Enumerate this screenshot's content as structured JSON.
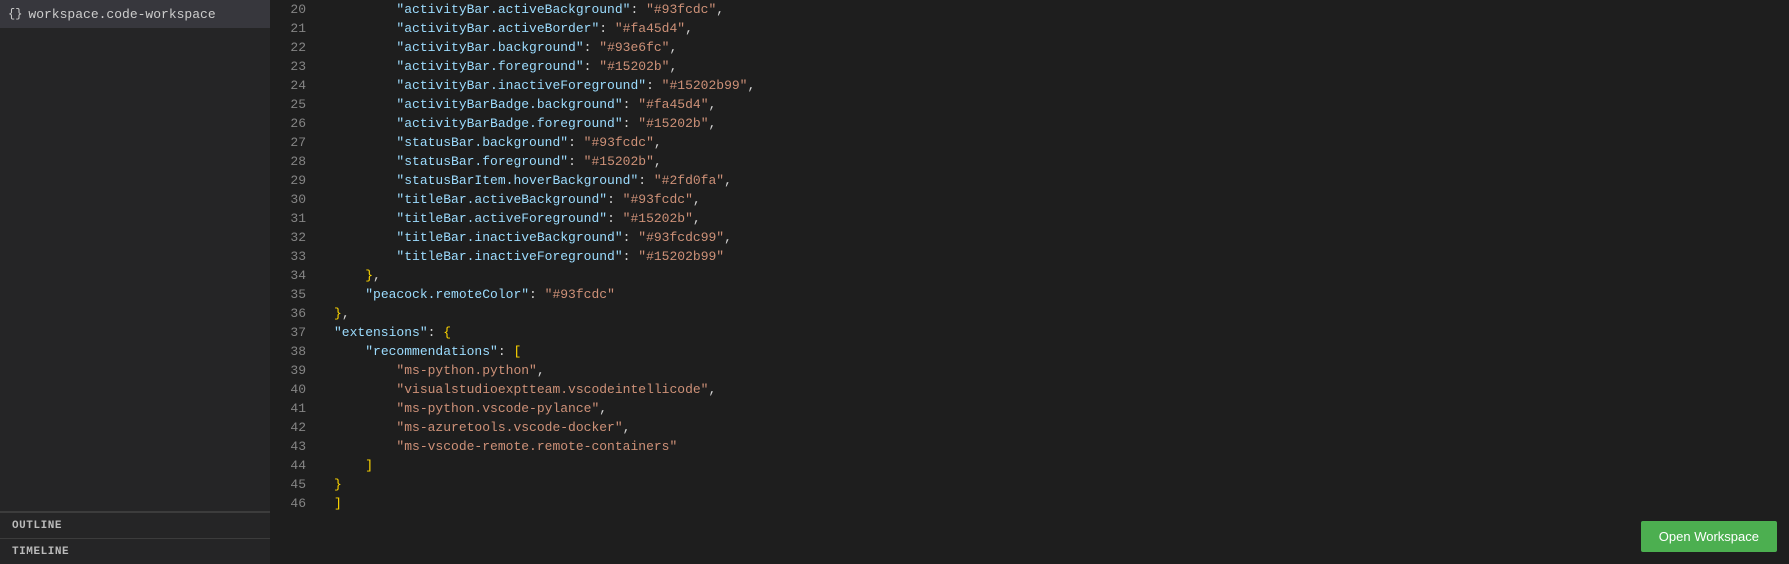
{
  "sidebar": {
    "file_item": {
      "icon": "{}",
      "label": "workspace.code-workspace"
    },
    "outline_label": "OUTLINE",
    "timeline_label": "TIMELINE"
  },
  "editor": {
    "lines": [
      {
        "num": 20,
        "content": [
          {
            "type": "indent",
            "text": "        "
          },
          {
            "type": "key",
            "text": "\"activityBar.activeBackground\""
          },
          {
            "type": "punct",
            "text": ": "
          },
          {
            "type": "hex-val",
            "text": "\"#93fcdc\""
          },
          {
            "type": "punct",
            "text": ","
          }
        ]
      },
      {
        "num": 21,
        "content": [
          {
            "type": "indent",
            "text": "        "
          },
          {
            "type": "key",
            "text": "\"activityBar.activeBorder\""
          },
          {
            "type": "punct",
            "text": ": "
          },
          {
            "type": "hex-val",
            "text": "\"#fa45d4\""
          },
          {
            "type": "punct",
            "text": ","
          }
        ]
      },
      {
        "num": 22,
        "content": [
          {
            "type": "indent",
            "text": "        "
          },
          {
            "type": "key",
            "text": "\"activityBar.background\""
          },
          {
            "type": "punct",
            "text": ": "
          },
          {
            "type": "hex-val",
            "text": "\"#93e6fc\""
          },
          {
            "type": "punct",
            "text": ","
          }
        ]
      },
      {
        "num": 23,
        "content": [
          {
            "type": "indent",
            "text": "        "
          },
          {
            "type": "key",
            "text": "\"activityBar.foreground\""
          },
          {
            "type": "punct",
            "text": ": "
          },
          {
            "type": "hex-val",
            "text": "\"#15202b\""
          },
          {
            "type": "punct",
            "text": ","
          }
        ]
      },
      {
        "num": 24,
        "content": [
          {
            "type": "indent",
            "text": "        "
          },
          {
            "type": "key",
            "text": "\"activityBar.inactiveForeground\""
          },
          {
            "type": "punct",
            "text": ": "
          },
          {
            "type": "hex-val",
            "text": "\"#15202b99\""
          },
          {
            "type": "punct",
            "text": ","
          }
        ]
      },
      {
        "num": 25,
        "content": [
          {
            "type": "indent",
            "text": "        "
          },
          {
            "type": "key",
            "text": "\"activityBarBadge.background\""
          },
          {
            "type": "punct",
            "text": ": "
          },
          {
            "type": "hex-val",
            "text": "\"#fa45d4\""
          },
          {
            "type": "punct",
            "text": ","
          }
        ]
      },
      {
        "num": 26,
        "content": [
          {
            "type": "indent",
            "text": "        "
          },
          {
            "type": "key",
            "text": "\"activityBarBadge.foreground\""
          },
          {
            "type": "punct",
            "text": ": "
          },
          {
            "type": "hex-val",
            "text": "\"#15202b\""
          },
          {
            "type": "punct",
            "text": ","
          }
        ]
      },
      {
        "num": 27,
        "content": [
          {
            "type": "indent",
            "text": "        "
          },
          {
            "type": "key",
            "text": "\"statusBar.background\""
          },
          {
            "type": "punct",
            "text": ": "
          },
          {
            "type": "hex-val",
            "text": "\"#93fcdc\""
          },
          {
            "type": "punct",
            "text": ","
          }
        ]
      },
      {
        "num": 28,
        "content": [
          {
            "type": "indent",
            "text": "        "
          },
          {
            "type": "key",
            "text": "\"statusBar.foreground\""
          },
          {
            "type": "punct",
            "text": ": "
          },
          {
            "type": "hex-val",
            "text": "\"#15202b\""
          },
          {
            "type": "punct",
            "text": ","
          }
        ]
      },
      {
        "num": 29,
        "content": [
          {
            "type": "indent",
            "text": "        "
          },
          {
            "type": "key",
            "text": "\"statusBarItem.hoverBackground\""
          },
          {
            "type": "punct",
            "text": ": "
          },
          {
            "type": "hex-val",
            "text": "\"#2fd0fa\""
          },
          {
            "type": "punct",
            "text": ","
          }
        ]
      },
      {
        "num": 30,
        "content": [
          {
            "type": "indent",
            "text": "        "
          },
          {
            "type": "key",
            "text": "\"titleBar.activeBackground\""
          },
          {
            "type": "punct",
            "text": ": "
          },
          {
            "type": "hex-val",
            "text": "\"#93fcdc\""
          },
          {
            "type": "punct",
            "text": ","
          }
        ]
      },
      {
        "num": 31,
        "content": [
          {
            "type": "indent",
            "text": "        "
          },
          {
            "type": "key",
            "text": "\"titleBar.activeForeground\""
          },
          {
            "type": "punct",
            "text": ": "
          },
          {
            "type": "hex-val",
            "text": "\"#15202b\""
          },
          {
            "type": "punct",
            "text": ","
          }
        ]
      },
      {
        "num": 32,
        "content": [
          {
            "type": "indent",
            "text": "        "
          },
          {
            "type": "key",
            "text": "\"titleBar.inactiveBackground\""
          },
          {
            "type": "punct",
            "text": ": "
          },
          {
            "type": "hex-val",
            "text": "\"#93fcdc99\""
          },
          {
            "type": "punct",
            "text": ","
          }
        ]
      },
      {
        "num": 33,
        "content": [
          {
            "type": "indent",
            "text": "        "
          },
          {
            "type": "key",
            "text": "\"titleBar.inactiveForeground\""
          },
          {
            "type": "punct",
            "text": ": "
          },
          {
            "type": "hex-val",
            "text": "\"#15202b99\""
          }
        ]
      },
      {
        "num": 34,
        "content": [
          {
            "type": "indent",
            "text": "    "
          },
          {
            "type": "brace",
            "text": "}"
          },
          {
            "type": "punct",
            "text": ","
          }
        ]
      },
      {
        "num": 35,
        "content": [
          {
            "type": "indent",
            "text": "    "
          },
          {
            "type": "key",
            "text": "\"peacock.remoteColor\""
          },
          {
            "type": "punct",
            "text": ": "
          },
          {
            "type": "hex-val",
            "text": "\"#93fcdc\""
          }
        ]
      },
      {
        "num": 36,
        "content": [
          {
            "type": "indent",
            "text": ""
          },
          {
            "type": "brace",
            "text": "}"
          },
          {
            "type": "punct",
            "text": ","
          }
        ]
      },
      {
        "num": 37,
        "content": [
          {
            "type": "indent",
            "text": ""
          },
          {
            "type": "key",
            "text": "\"extensions\""
          },
          {
            "type": "punct",
            "text": ": "
          },
          {
            "type": "brace",
            "text": "{"
          }
        ]
      },
      {
        "num": 38,
        "content": [
          {
            "type": "indent",
            "text": "    "
          },
          {
            "type": "key",
            "text": "\"recommendations\""
          },
          {
            "type": "punct",
            "text": ": "
          },
          {
            "type": "bracket",
            "text": "["
          }
        ]
      },
      {
        "num": 39,
        "content": [
          {
            "type": "indent",
            "text": "        "
          },
          {
            "type": "string-val",
            "text": "\"ms-python.python\""
          },
          {
            "type": "punct",
            "text": ","
          }
        ]
      },
      {
        "num": 40,
        "content": [
          {
            "type": "indent",
            "text": "        "
          },
          {
            "type": "string-val",
            "text": "\"visualstudioexptteam.vscodeintellicode\""
          },
          {
            "type": "punct",
            "text": ","
          }
        ]
      },
      {
        "num": 41,
        "content": [
          {
            "type": "indent",
            "text": "        "
          },
          {
            "type": "string-val",
            "text": "\"ms-python.vscode-pylance\""
          },
          {
            "type": "punct",
            "text": ","
          }
        ]
      },
      {
        "num": 42,
        "content": [
          {
            "type": "indent",
            "text": "        "
          },
          {
            "type": "string-val",
            "text": "\"ms-azuretools.vscode-docker\""
          },
          {
            "type": "punct",
            "text": ","
          }
        ]
      },
      {
        "num": 43,
        "content": [
          {
            "type": "indent",
            "text": "        "
          },
          {
            "type": "string-val",
            "text": "\"ms-vscode-remote.remote-containers\""
          }
        ]
      },
      {
        "num": 44,
        "content": [
          {
            "type": "indent",
            "text": "    "
          },
          {
            "type": "bracket",
            "text": "]"
          }
        ]
      },
      {
        "num": 45,
        "content": [
          {
            "type": "indent",
            "text": ""
          },
          {
            "type": "brace",
            "text": "}"
          }
        ]
      },
      {
        "num": 46,
        "content": [
          {
            "type": "brace",
            "text": "]"
          }
        ]
      }
    ]
  },
  "button": {
    "open_workspace": "Open Workspace"
  }
}
